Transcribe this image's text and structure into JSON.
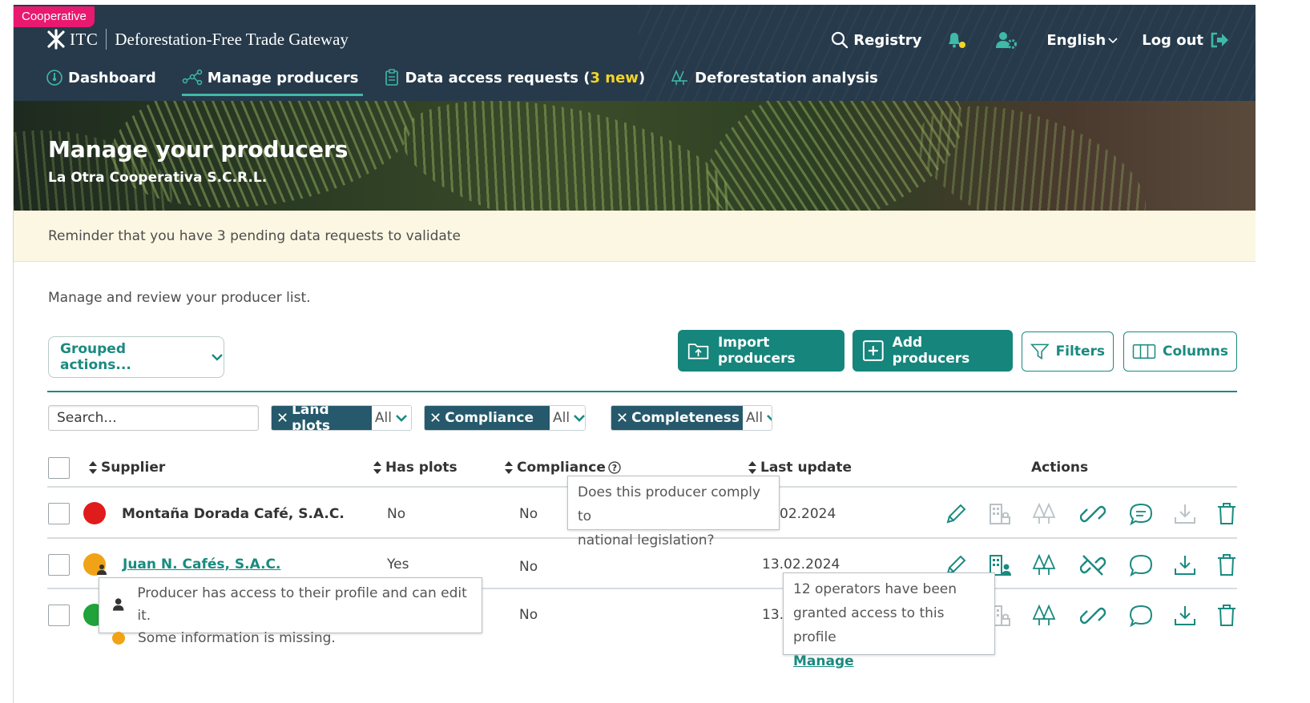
{
  "badge": "Cooperative",
  "brand": {
    "logo_text": "ITC",
    "app_name": "Deforestation-Free Trade Gateway"
  },
  "topnav": {
    "registry": "Registry",
    "language": "English",
    "logout": "Log out"
  },
  "mainnav": {
    "dashboard": "Dashboard",
    "manage_producers": "Manage producers",
    "data_access_prefix": "Data access requests (",
    "data_access_new": "3 new",
    "data_access_suffix": ")",
    "deforestation": "Deforestation analysis"
  },
  "hero": {
    "title": "Manage your producers",
    "subtitle": "La Otra Cooperativa S.C.R.L."
  },
  "reminder": "Reminder that you have 3 pending data requests to validate",
  "intro": "Manage and review your producer list.",
  "toolbar": {
    "grouped_actions": "Grouped actions...",
    "import": "Import producers",
    "add": "Add producers",
    "filters": "Filters",
    "columns": "Columns"
  },
  "search": {
    "placeholder": "Search..."
  },
  "filters": [
    {
      "label": "Land plots",
      "value": "All"
    },
    {
      "label": "Compliance",
      "value": "All"
    },
    {
      "label": "Completeness",
      "value": "All"
    }
  ],
  "table": {
    "headers": {
      "supplier": "Supplier",
      "has_plots": "Has plots",
      "compliance": "Compliance",
      "last_update": "Last update",
      "actions": "Actions"
    },
    "rows": [
      {
        "status_color": "#e01b1b",
        "supplier": "Montaña Dorada Café, S.A.C.",
        "has_plots": "No",
        "compliance": "No",
        "last_update": "02.2024"
      },
      {
        "status_color": "#f0a316",
        "supplier": "Juan N. Cafés, S.A.C.",
        "has_plots": "Yes",
        "compliance": "No",
        "last_update": "13.02.2024"
      },
      {
        "status_color": "#1fa33a",
        "supplier": "",
        "has_plots": "",
        "compliance": "No",
        "last_update": "13.0"
      }
    ]
  },
  "tooltips": {
    "compliance_1": "Does this producer comply to",
    "compliance_2": "national legislation?",
    "status_1": "Producer has access to their profile and can edit it.",
    "status_2": "Some information is missing.",
    "operators_1": "12 operators have been",
    "operators_2": "granted access to this profile",
    "operators_link": "Manage"
  },
  "colors": {
    "header": "#263a4b",
    "accent": "#16857c",
    "badge": "#e8196f",
    "highlight": "#f4d428"
  }
}
